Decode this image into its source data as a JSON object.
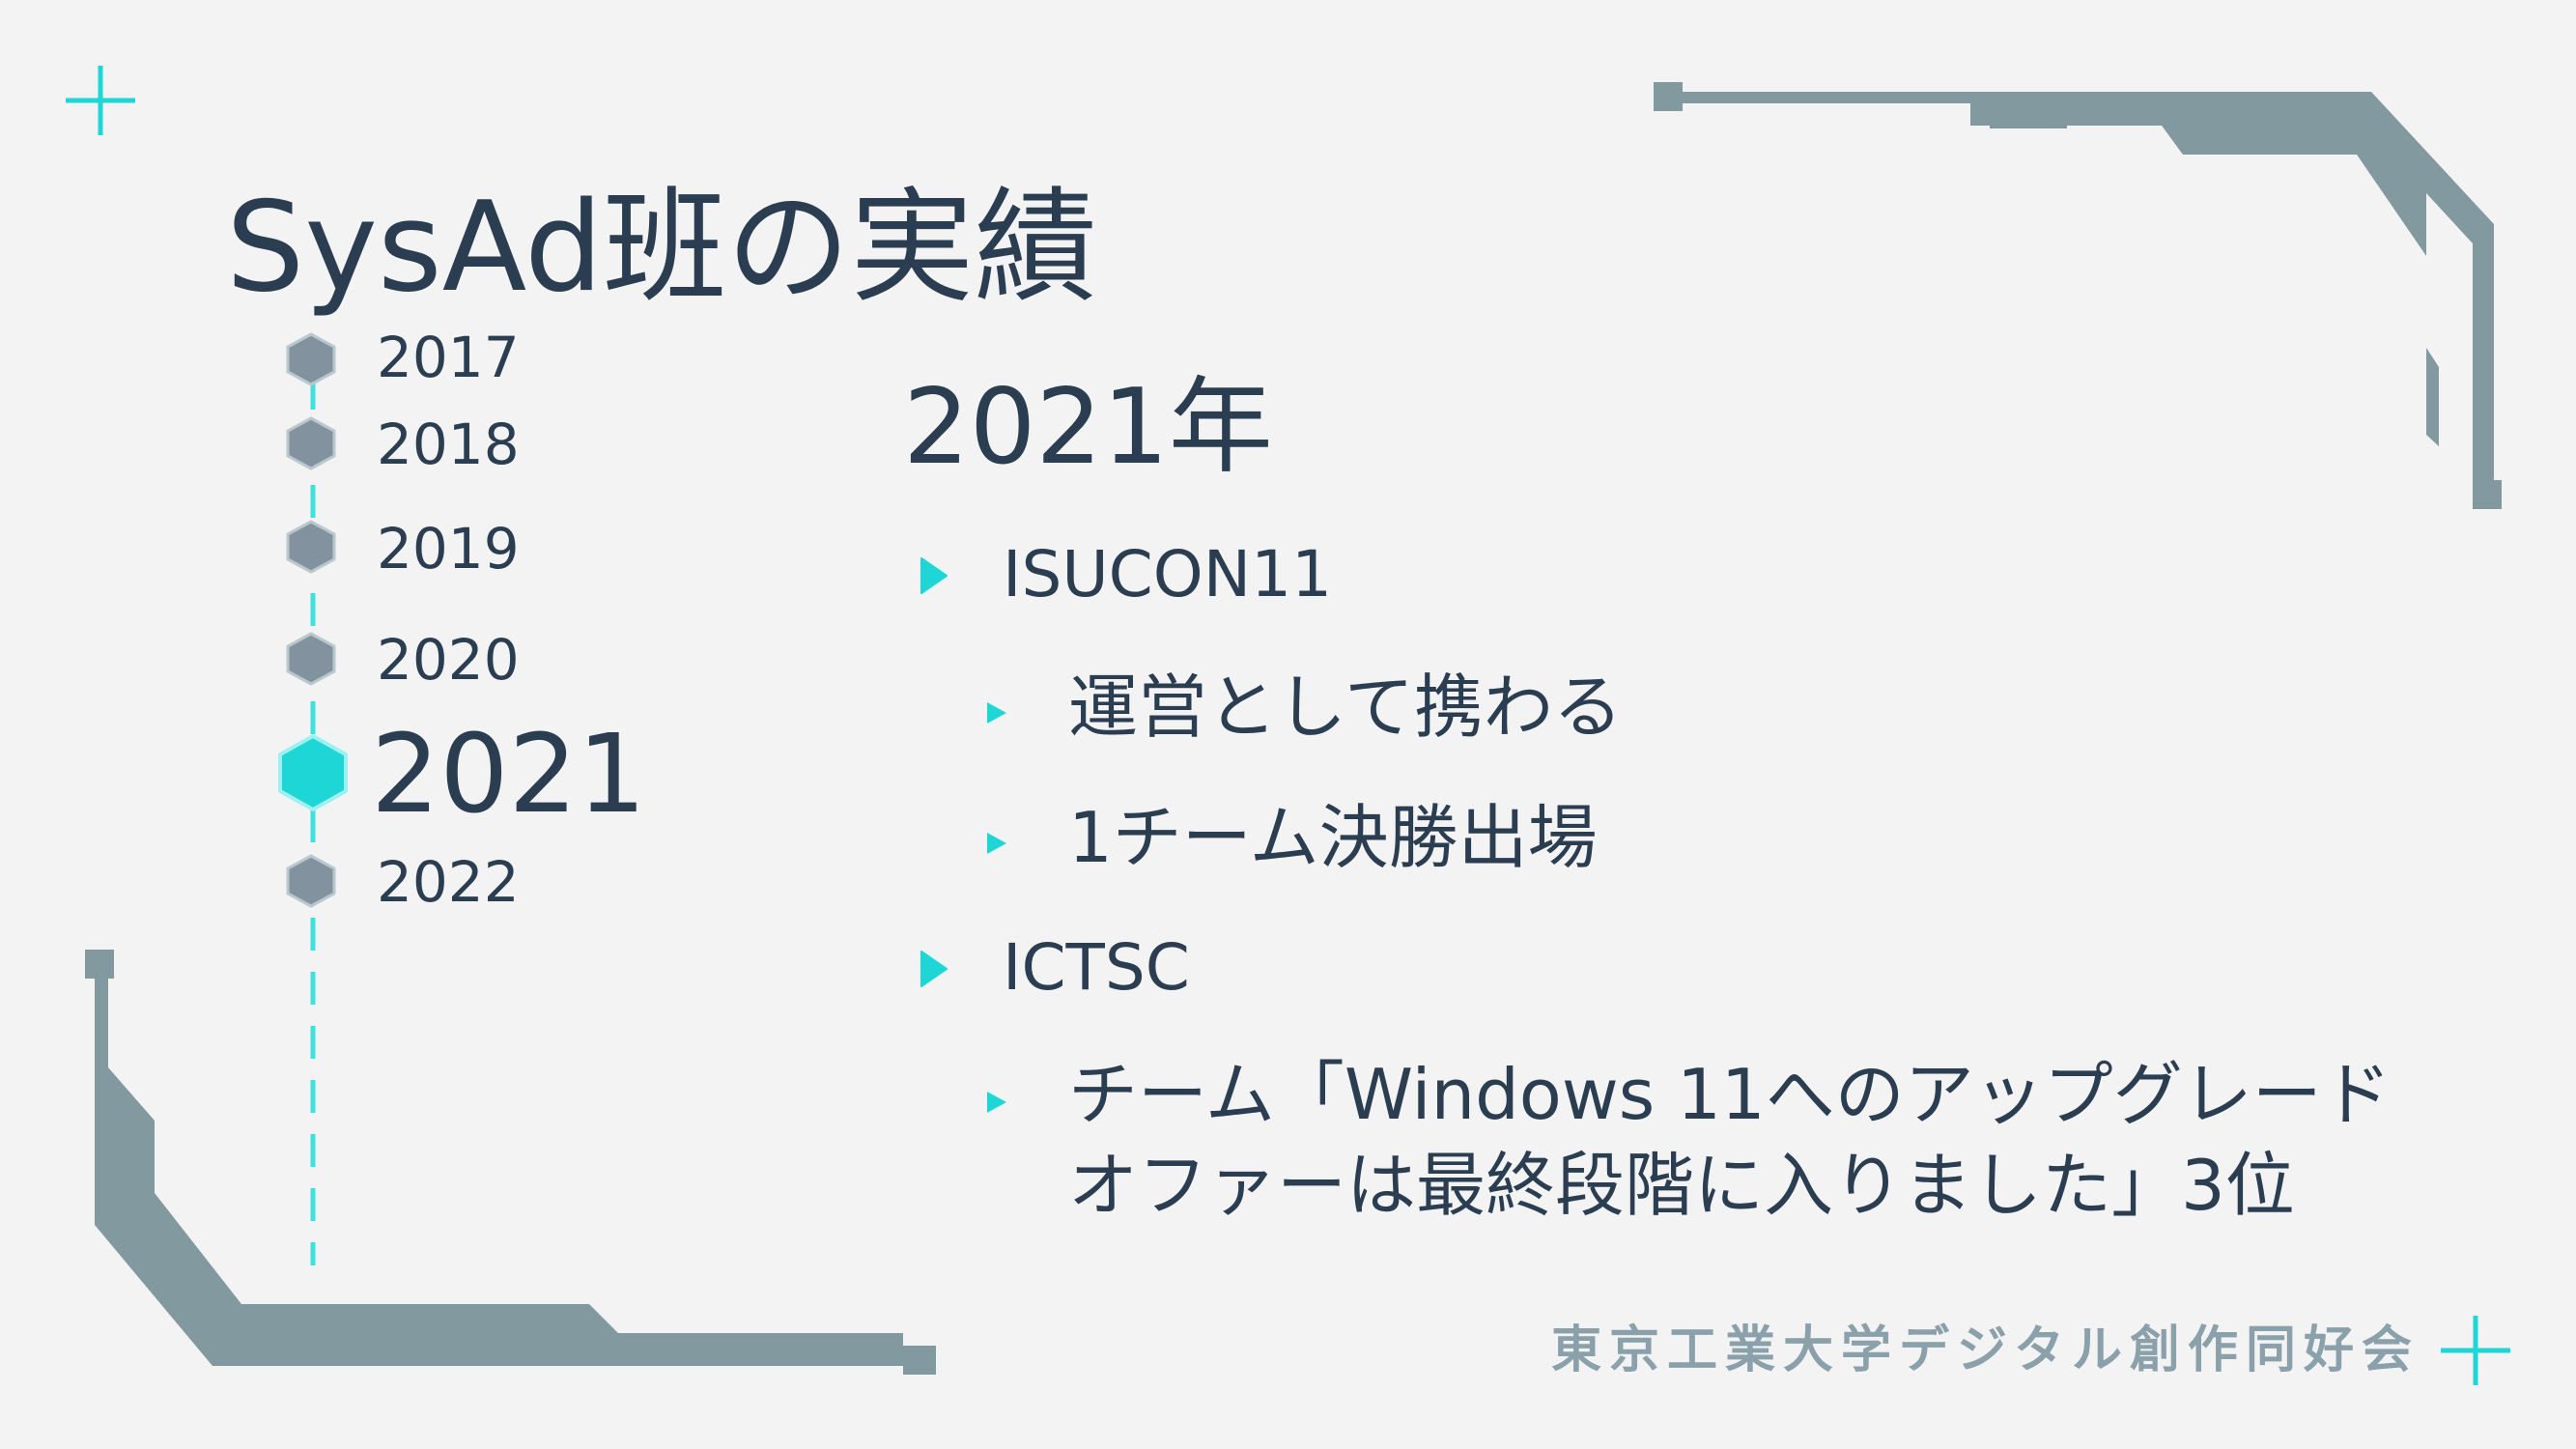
{
  "slide": {
    "title": "SysAd班の実績",
    "timeline": {
      "years": [
        "2017",
        "2018",
        "2019",
        "2020",
        "2021",
        "2022"
      ],
      "active_year": "2021"
    },
    "section_title": "2021年",
    "items": [
      {
        "text": "ISUCON11",
        "children": [
          "運営として携わる",
          "1チーム決勝出場"
        ]
      },
      {
        "text": "ICTSC",
        "children_lines": [
          "チーム「Windows 11へのアップグレード",
          "オファーは最終段階に入りました」3位"
        ]
      }
    ],
    "footer_org": "東京工業大学デジタル創作同好会"
  },
  "colors": {
    "background": "#f3f3f3",
    "text": "#2b3d51",
    "accent": "#1ed6d6",
    "frame": "#82999f",
    "marker_inactive": "#82939f"
  },
  "icons": [
    "plus-icon",
    "hexagon-marker-icon",
    "triangle-bullet-icon"
  ]
}
